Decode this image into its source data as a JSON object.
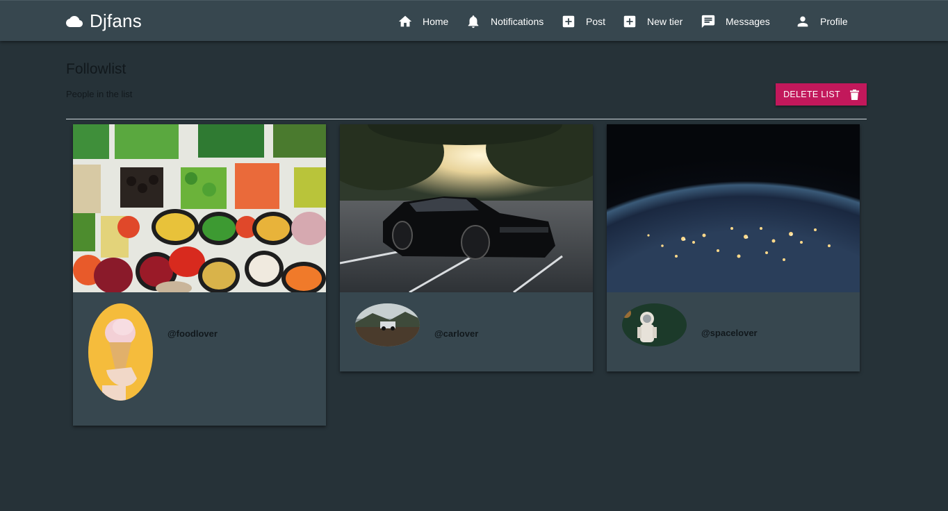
{
  "app": {
    "name": "Djfans"
  },
  "nav": {
    "items": [
      {
        "label": "Home",
        "icon": "home-icon"
      },
      {
        "label": "Notifications",
        "icon": "bell-icon"
      },
      {
        "label": "Post",
        "icon": "plus-box-icon"
      },
      {
        "label": "New tier",
        "icon": "plus-box-icon"
      },
      {
        "label": "Messages",
        "icon": "message-icon"
      },
      {
        "label": "Profile",
        "icon": "person-icon"
      }
    ]
  },
  "page": {
    "title": "Followlist",
    "subtitle": "People in the list",
    "delete_button": "DELETE LIST"
  },
  "cards": [
    {
      "handle": "@foodlover",
      "cover": "vegetable platter photo",
      "avatar": "ice cream cone photo"
    },
    {
      "handle": "@carlover",
      "cover": "black sports car photo",
      "avatar": "car in mountains photo"
    },
    {
      "handle": "@spacelover",
      "cover": "earth at night photo",
      "avatar": "astronaut photo"
    }
  ],
  "colors": {
    "background": "#263238",
    "topbar": "#37474f",
    "card": "#37474f",
    "accent": "#c2185b",
    "dark_text": "#11181c"
  }
}
